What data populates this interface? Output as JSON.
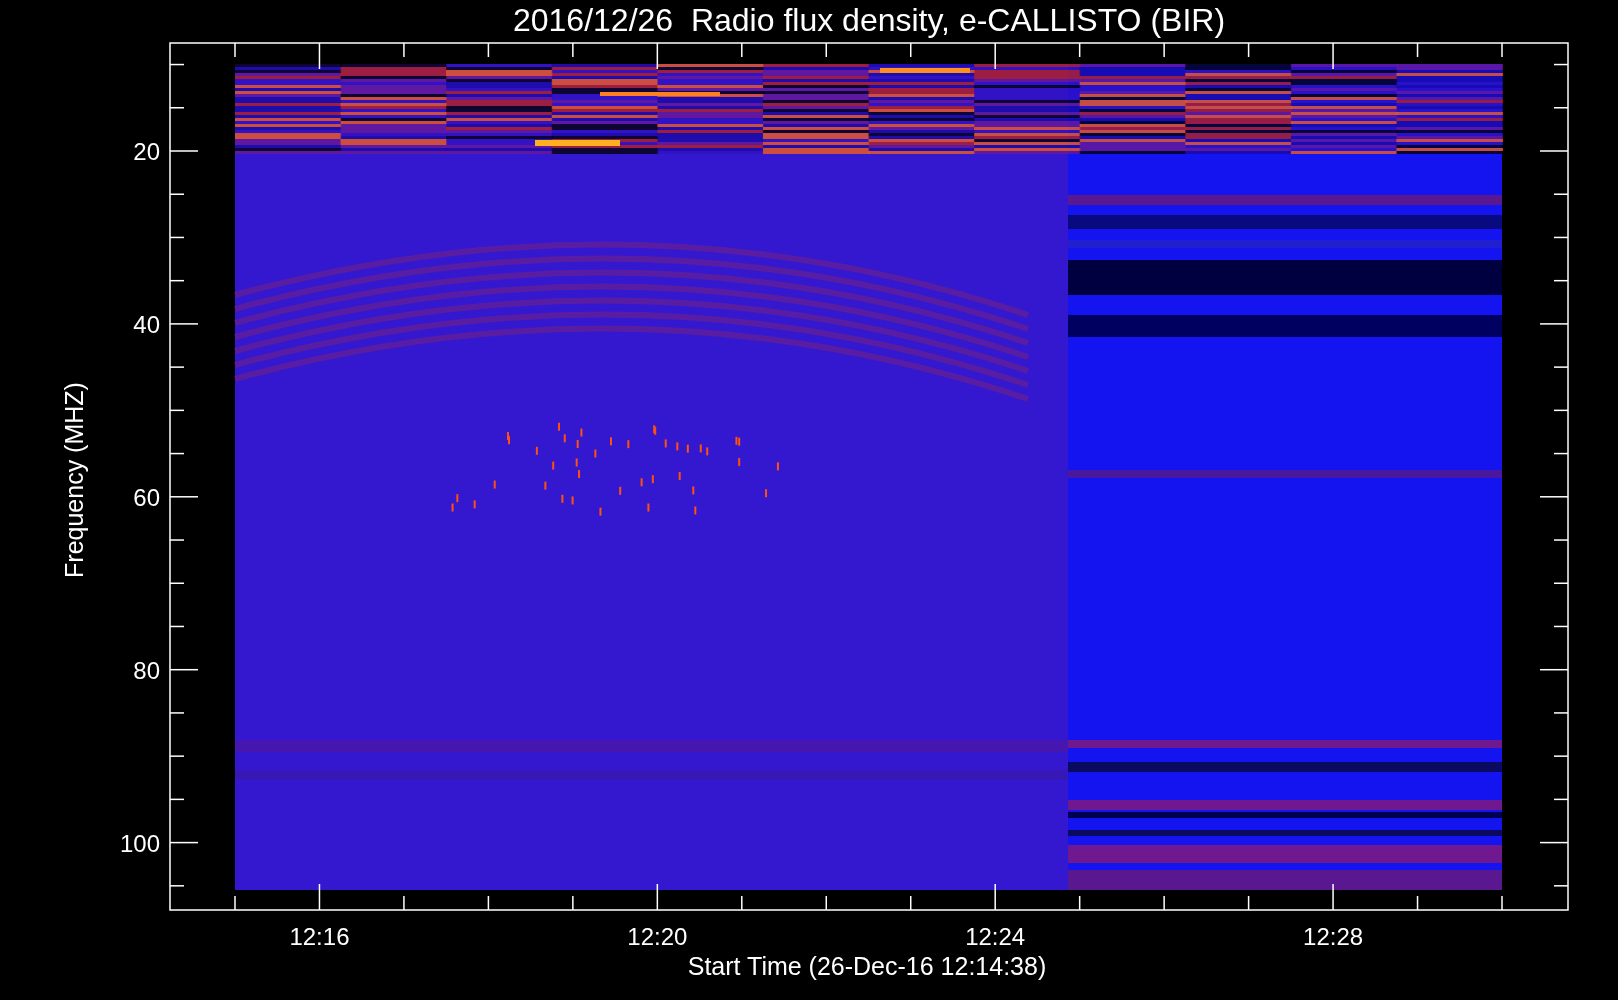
{
  "title": "2016/12/26  Radio flux density, e-CALLISTO (BIR)",
  "y_axis": {
    "label": "Frequency (MHZ)",
    "ticks": [
      "20",
      "40",
      "60",
      "80",
      "100"
    ]
  },
  "x_axis": {
    "label": "Start Time (26-Dec-16 12:14:38)",
    "ticks": [
      "12:16",
      "12:20",
      "12:24",
      "12:28"
    ]
  }
}
